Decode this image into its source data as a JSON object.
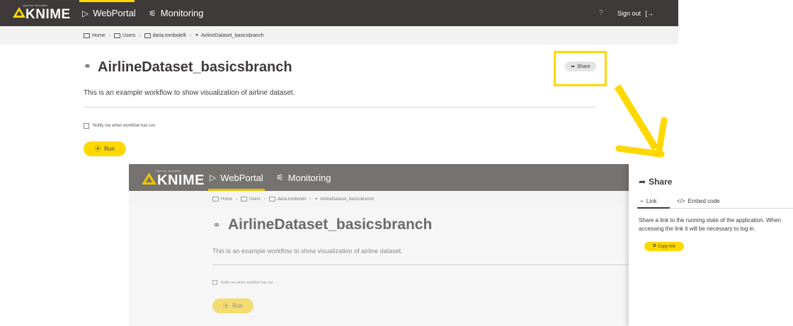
{
  "brand": {
    "tagline": "Open for Innovation",
    "name": "KNIME",
    "accent": "#ffd800",
    "dark": "#3e3a39"
  },
  "nav": {
    "items": [
      {
        "label": "WebPortal",
        "icon": "play-triangle-icon",
        "active": true
      },
      {
        "label": "Monitoring",
        "icon": "monitoring-icon",
        "active": false
      }
    ],
    "help": "?",
    "signout": "Sign out"
  },
  "breadcrumb": [
    "Home",
    "Users",
    "daria.tombolelli",
    "AirlineDataset_basicsbranch"
  ],
  "workflow": {
    "title": "AirlineDataset_basicsbranch",
    "description": "This is an example workflow to show visualization of airline dataset.",
    "notify_label": "Notify me when workflow has run",
    "run_label": "Run",
    "share_label": "Share"
  },
  "share_panel": {
    "title": "Share",
    "tabs": [
      {
        "label": "Link",
        "active": true
      },
      {
        "label": "Embed code",
        "active": false
      }
    ],
    "text": "Share a link to the running state of the application. When accessing the link it will be necessary to log in.",
    "copy_label": "Copy link"
  }
}
